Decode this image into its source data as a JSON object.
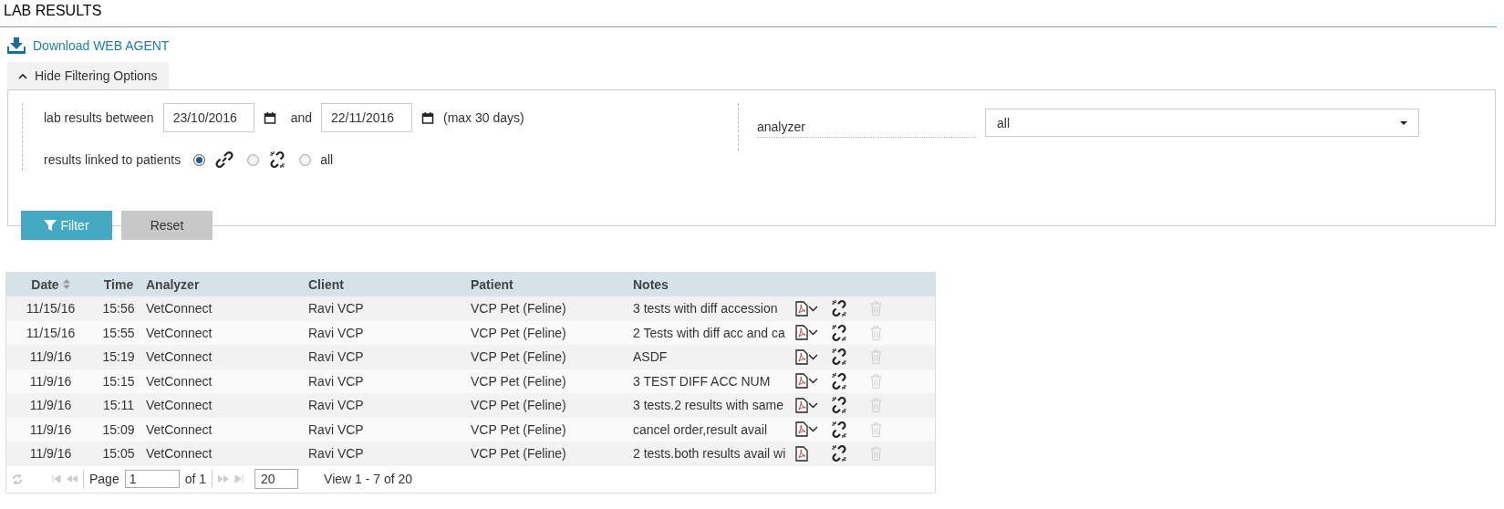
{
  "page_title": "LAB RESULTS",
  "download_link": "Download WEB AGENT",
  "filter_toggle": {
    "label": "Hide Filtering Options",
    "expanded": true
  },
  "filters": {
    "date_label": "lab results between",
    "from": "23/10/2016",
    "and_label": "and",
    "to": "22/11/2016",
    "hint": "(max 30 days)",
    "linked_label": "results linked to patients",
    "link_options": [
      {
        "kind": "linked",
        "selected": true
      },
      {
        "kind": "unlinked",
        "selected": false
      },
      {
        "kind": "text",
        "label": "all",
        "selected": false
      }
    ],
    "analyzer_label": "analyzer",
    "analyzer_value": "all"
  },
  "buttons": [
    {
      "kind": "primary",
      "label": "Filter"
    },
    {
      "kind": "secondary",
      "label": "Reset"
    }
  ],
  "table": {
    "columns": [
      {
        "label": "Date",
        "sortable": true
      },
      {
        "label": "Time",
        "sortable": false
      },
      {
        "label": "Analyzer",
        "sortable": false
      },
      {
        "label": "Client",
        "sortable": false
      },
      {
        "label": "Patient",
        "sortable": false
      },
      {
        "label": "Notes",
        "sortable": false
      }
    ],
    "rows": [
      {
        "date": "11/15/16",
        "time": "15:56",
        "analyzer": "VetConnect",
        "client": "Ravi VCP",
        "patient": "VCP Pet (Feline)",
        "notes": "3 tests with diff accession",
        "pdf_menu": true
      },
      {
        "date": "11/15/16",
        "time": "15:55",
        "analyzer": "VetConnect",
        "client": "Ravi VCP",
        "patient": "VCP Pet (Feline)",
        "notes": "2 Tests with diff acc and ca",
        "pdf_menu": true
      },
      {
        "date": "11/9/16",
        "time": "15:19",
        "analyzer": "VetConnect",
        "client": "Ravi VCP",
        "patient": "VCP Pet (Feline)",
        "notes": "ASDF",
        "pdf_menu": true
      },
      {
        "date": "11/9/16",
        "time": "15:15",
        "analyzer": "VetConnect",
        "client": "Ravi VCP",
        "patient": "VCP Pet (Feline)",
        "notes": "3 TEST DIFF ACC NUM",
        "pdf_menu": true
      },
      {
        "date": "11/9/16",
        "time": "15:11",
        "analyzer": "VetConnect",
        "client": "Ravi VCP",
        "patient": "VCP Pet (Feline)",
        "notes": "3 tests.2 results with same",
        "pdf_menu": true
      },
      {
        "date": "11/9/16",
        "time": "15:09",
        "analyzer": "VetConnect",
        "client": "Ravi VCP",
        "patient": "VCP Pet (Feline)",
        "notes": "cancel order,result avail",
        "pdf_menu": true
      },
      {
        "date": "11/9/16",
        "time": "15:05",
        "analyzer": "VetConnect",
        "client": "Ravi VCP",
        "patient": "VCP Pet (Feline)",
        "notes": "2 tests.both results avail wi",
        "pdf_menu": false
      }
    ]
  },
  "pager": {
    "page_label": "Page",
    "page": "1",
    "of_label": "of 1",
    "page_size": "20",
    "summary": "View 1 - 7 of 20"
  }
}
